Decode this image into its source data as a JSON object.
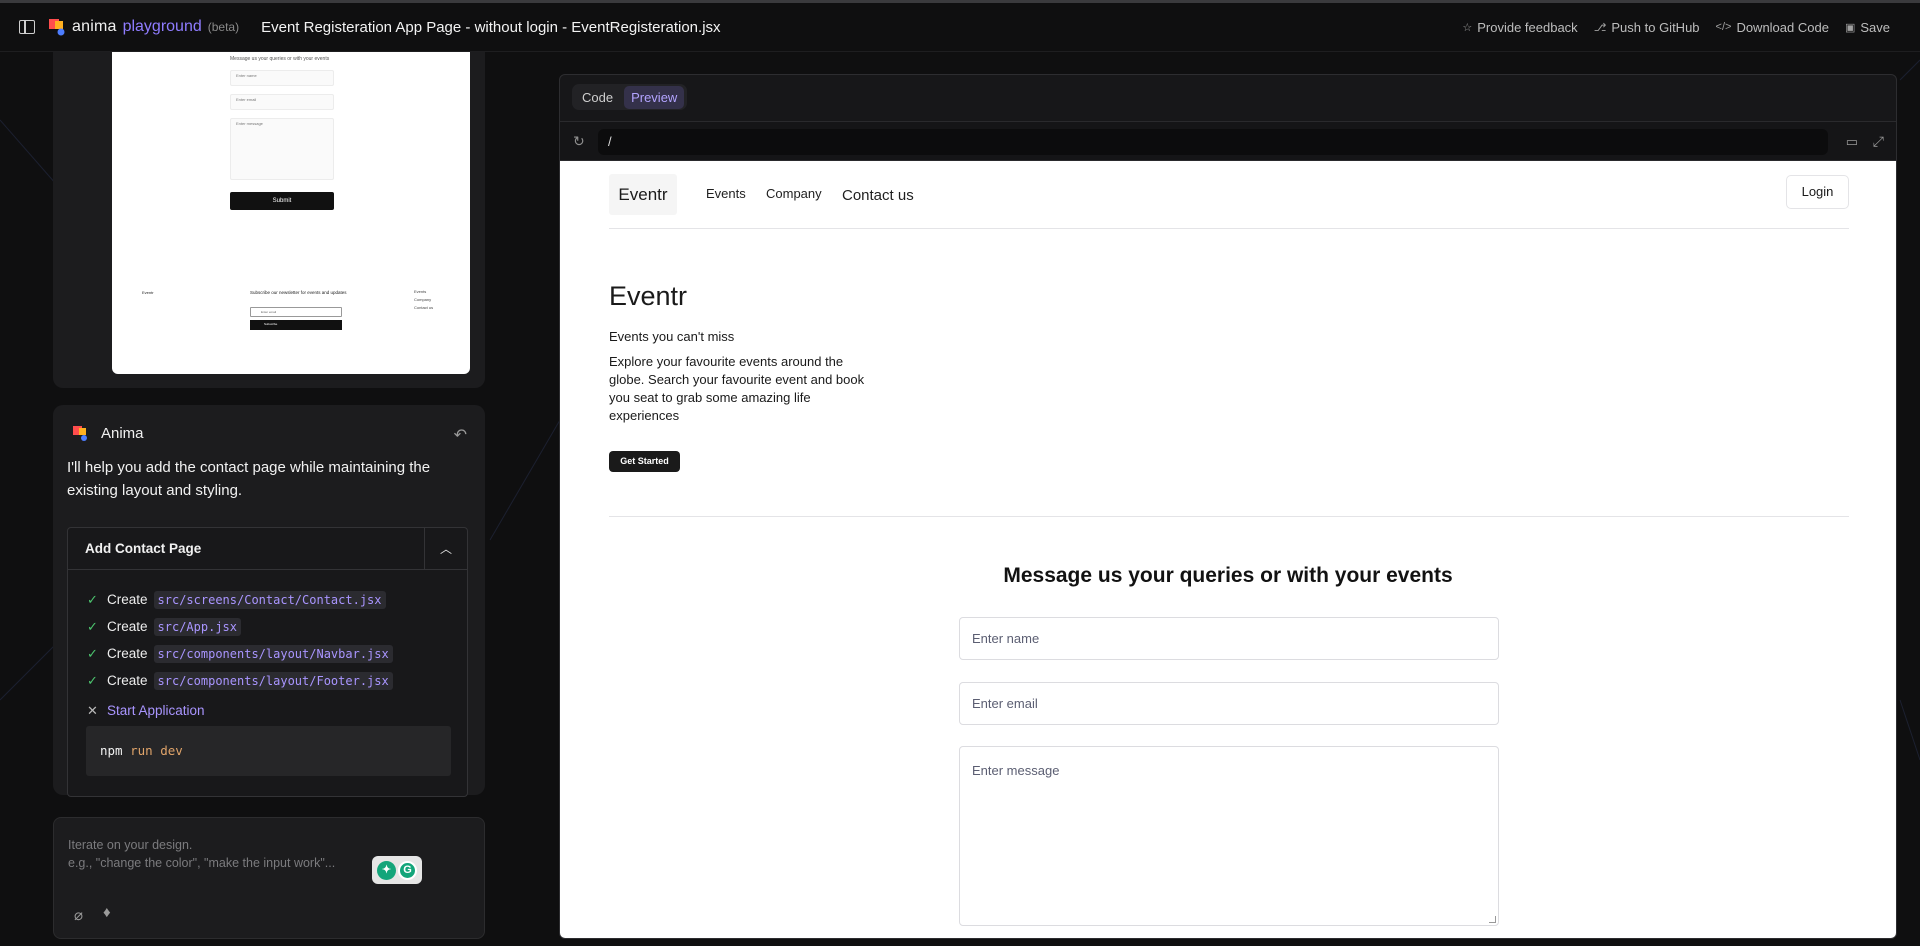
{
  "topbar": {
    "brand_word": "anima",
    "brand_sub": "playground",
    "brand_beta": "(beta)",
    "title": "Event Registeration App Page - without login - EventRegisteration.jsx",
    "actions": [
      {
        "label": "Provide feedback",
        "icon": "☆"
      },
      {
        "label": "Push to GitHub",
        "icon": "⎇"
      },
      {
        "label": "Download Code",
        "icon": "</>"
      },
      {
        "label": "Save",
        "icon": "▣"
      }
    ]
  },
  "mini_preview": {
    "heading": "Message us your queries or with your events",
    "name_ph": "Enter name",
    "email_ph": "Enter email",
    "message_ph": "Enter message",
    "submit": "Submit",
    "footer_brand": "Eventr",
    "footer_newsletter": "Subscribe our newsletter for events and updates",
    "footer_email_ph": "Enter email",
    "footer_subscribe": "Subscribe",
    "footer_links": [
      "Events",
      "Company",
      "Contact us"
    ]
  },
  "chat": {
    "name": "Anima",
    "message": "I'll help you add the contact page while maintaining the existing layout and styling.",
    "task_title": "Add Contact Page",
    "steps": [
      {
        "verb": "Create",
        "path": "src/screens/Contact/Contact.jsx"
      },
      {
        "verb": "Create",
        "path": "src/App.jsx"
      },
      {
        "verb": "Create",
        "path": "src/components/layout/Navbar.jsx"
      },
      {
        "verb": "Create",
        "path": "src/components/layout/Footer.jsx"
      }
    ],
    "start_label": "Start Application",
    "cmd_main": "npm",
    "cmd_args": "run dev"
  },
  "prompt": {
    "line1": "Iterate on your design.",
    "line2": "e.g., \"change the color\", \"make the input work\"..."
  },
  "frame": {
    "tabs": [
      "Code",
      "Preview"
    ],
    "active_tab": "Preview",
    "url": "/"
  },
  "app": {
    "brand": "Eventr",
    "nav": [
      "Events",
      "Company",
      "Contact us"
    ],
    "login": "Login",
    "hero_title": "Eventr",
    "hero_tag": "Events you can't miss",
    "hero_desc": "Explore your favourite events around the globe. Search your favourite event and book you seat to grab some amazing life experiences",
    "cta": "Get Started",
    "contact_title": "Message us your queries or with your events",
    "name_ph": "Enter name",
    "email_ph": "Enter email",
    "message_ph": "Enter message"
  },
  "colors": {
    "accent": "#8f7cff",
    "success": "#4cc46e",
    "bg": "#0f0f10",
    "panel": "#1c1c1e"
  }
}
